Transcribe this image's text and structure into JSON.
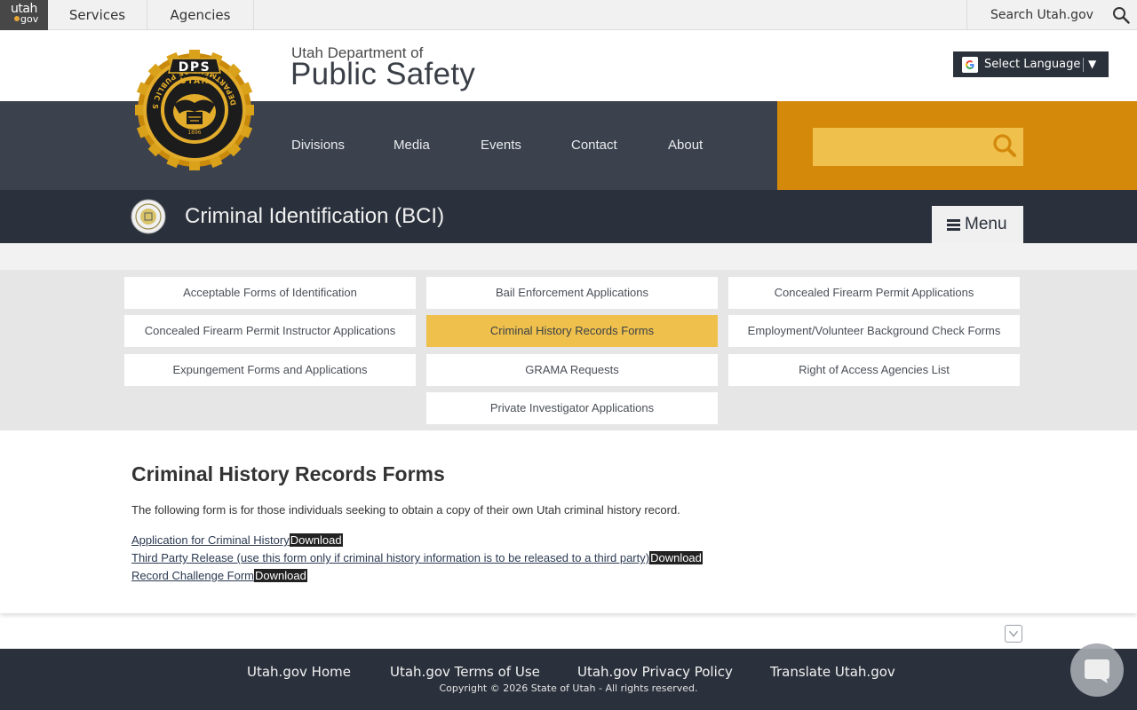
{
  "topbar": {
    "logo_line1": "utah",
    "logo_line2": "gov",
    "services": "Services",
    "agencies": "Agencies",
    "search_label": "Search Utah.gov"
  },
  "header": {
    "dept_small": "Utah Department of",
    "dept_big": "Public Safety",
    "language_button": "Select Language",
    "language_arrow": "▼"
  },
  "seal": {
    "top_text": "DPS",
    "arc_text": "UTAH",
    "ring_text": "DEPARTMENT OF PUBLIC SAFETY",
    "year": "1896"
  },
  "nav": {
    "items": [
      "Divisions",
      "Media",
      "Events",
      "Contact",
      "About"
    ],
    "search_placeholder": ""
  },
  "division": {
    "title": "Criminal Identification (BCI)",
    "menu_label": "Menu"
  },
  "grid": {
    "items": [
      {
        "label": "Acceptable Forms of Identification",
        "active": false
      },
      {
        "label": "Bail Enforcement Applications",
        "active": false
      },
      {
        "label": "Concealed Firearm Permit Applications",
        "active": false
      },
      {
        "label": "Concealed Firearm Permit Instructor Applications",
        "active": false
      },
      {
        "label": "Criminal History Records Forms",
        "active": true
      },
      {
        "label": "Employment/Volunteer Background Check Forms",
        "active": false
      },
      {
        "label": "Expungement Forms and Applications",
        "active": false
      },
      {
        "label": "GRAMA Requests",
        "active": false
      },
      {
        "label": "Right of Access Agencies List",
        "active": false
      },
      {
        "label": "Private Investigator Applications",
        "active": false
      }
    ]
  },
  "content": {
    "title": "Criminal History Records Forms",
    "intro": "The following form is for those individuals seeking to obtain a copy of their own Utah criminal history record.",
    "documents": [
      {
        "link": "Application for Criminal History",
        "download": "Download"
      },
      {
        "link": "Third Party Release (use this form only if criminal history information is to be released to a third party)",
        "download": "Download"
      },
      {
        "link": "Record Challenge Form",
        "download": "Download"
      }
    ]
  },
  "footer": {
    "links": [
      "Utah.gov Home",
      "Utah.gov Terms of Use",
      "Utah.gov Privacy Policy",
      "Translate Utah.gov"
    ],
    "copyright": "Copyright © 2026 State of Utah - All rights reserved."
  },
  "colors": {
    "nav_bg": "#3b414d",
    "division_bg": "#2b313c",
    "accent_orange": "#d4890b",
    "accent_gold": "#efc04c"
  },
  "icons": {
    "topbar_search": "search-icon",
    "nav_search": "search-icon",
    "menu": "hamburger-icon",
    "chat": "chat-icon",
    "collapse": "chevron-down-icon"
  }
}
